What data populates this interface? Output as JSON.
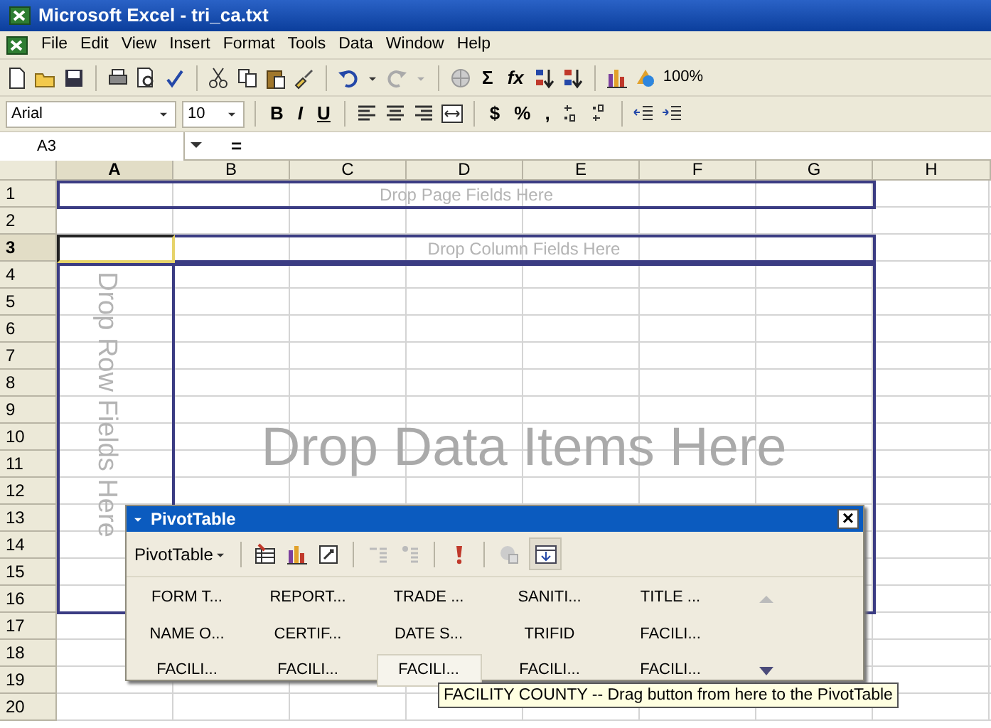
{
  "window": {
    "title": "Microsoft Excel - tri_ca.txt"
  },
  "menu": [
    "File",
    "Edit",
    "View",
    "Insert",
    "Format",
    "Tools",
    "Data",
    "Window",
    "Help"
  ],
  "standard_toolbar": {
    "autosum": "Σ",
    "function": "fx",
    "zoom": "100%"
  },
  "formatting_toolbar": {
    "font": "Arial",
    "size": "10",
    "bold": "B",
    "italic": "I",
    "underline": "U",
    "currency": "$",
    "percent": "%",
    "comma": ","
  },
  "formula_bar": {
    "name_box": "A3",
    "equals": "="
  },
  "columns": [
    {
      "label": "A",
      "selected": true
    },
    {
      "label": "B",
      "selected": false
    },
    {
      "label": "C",
      "selected": false
    },
    {
      "label": "D",
      "selected": false
    },
    {
      "label": "E",
      "selected": false
    },
    {
      "label": "F",
      "selected": false
    },
    {
      "label": "G",
      "selected": false
    },
    {
      "label": "H",
      "selected": false
    }
  ],
  "rows": [
    {
      "label": "1",
      "selected": false
    },
    {
      "label": "2",
      "selected": false
    },
    {
      "label": "3",
      "selected": true
    },
    {
      "label": "4",
      "selected": false
    },
    {
      "label": "5",
      "selected": false
    },
    {
      "label": "6",
      "selected": false
    },
    {
      "label": "7",
      "selected": false
    },
    {
      "label": "8",
      "selected": false
    },
    {
      "label": "9",
      "selected": false
    },
    {
      "label": "10",
      "selected": false
    },
    {
      "label": "11",
      "selected": false
    },
    {
      "label": "12",
      "selected": false
    },
    {
      "label": "13",
      "selected": false
    },
    {
      "label": "14",
      "selected": false
    },
    {
      "label": "15",
      "selected": false
    },
    {
      "label": "16",
      "selected": false
    },
    {
      "label": "17",
      "selected": false
    },
    {
      "label": "18",
      "selected": false
    },
    {
      "label": "19",
      "selected": false
    },
    {
      "label": "20",
      "selected": false
    }
  ],
  "pivot_areas": {
    "page_fields": "Drop Page Fields Here",
    "column_fields": "Drop Column Fields Here",
    "row_fields": "Drop Row Fields Here",
    "data_items": "Drop Data Items Here"
  },
  "pivot_toolbar": {
    "title": "PivotTable",
    "menu": "PivotTable",
    "close": "×",
    "fields": [
      {
        "label": "FORM T...",
        "selected": false
      },
      {
        "label": "REPORT...",
        "selected": false
      },
      {
        "label": "TRADE ...",
        "selected": false
      },
      {
        "label": "SANITI...",
        "selected": false
      },
      {
        "label": "TITLE ...",
        "selected": false
      },
      {
        "label": "NAME O...",
        "selected": false
      },
      {
        "label": "CERTIF...",
        "selected": false
      },
      {
        "label": "DATE S...",
        "selected": false
      },
      {
        "label": "TRIFID",
        "selected": false
      },
      {
        "label": "FACILI...",
        "selected": false
      },
      {
        "label": "FACILI...",
        "selected": false
      },
      {
        "label": "FACILI...",
        "selected": false
      },
      {
        "label": "FACILI...",
        "selected": true
      },
      {
        "label": "FACILI...",
        "selected": false
      },
      {
        "label": "FACILI...",
        "selected": false
      }
    ]
  },
  "tooltip": "FACILITY COUNTY -- Drag button from here to the PivotTable"
}
